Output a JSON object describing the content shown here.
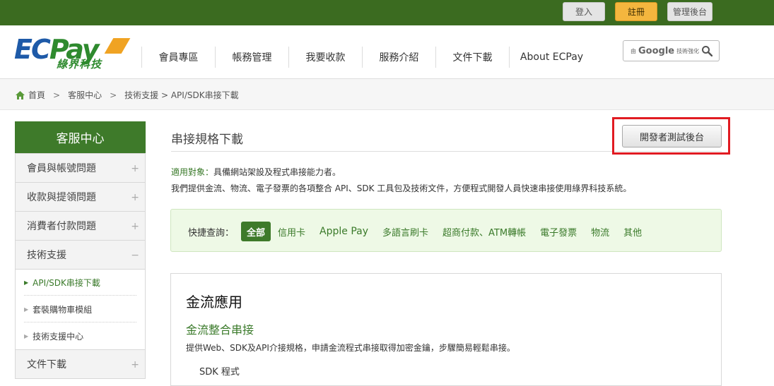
{
  "topbar": {
    "login": "登入",
    "register": "註冊",
    "admin": "管理後台",
    "bg_color": "#3b6b20",
    "register_color": "#f4b63e"
  },
  "logo": {
    "main": "ECPay",
    "sub": "綠界科技"
  },
  "nav": [
    {
      "label": "會員專區"
    },
    {
      "label": "帳務管理"
    },
    {
      "label": "我要收款"
    },
    {
      "label": "服務介紹"
    },
    {
      "label": "文件下載"
    },
    {
      "label": "About ECPay"
    }
  ],
  "search": {
    "prefix": "由",
    "brand": "Google",
    "suffix": "技術強化",
    "icon": "magnifier-icon"
  },
  "breadcrumb": {
    "home": "首頁",
    "sep1": ">",
    "level1": "客服中心",
    "sep2": ">",
    "level2": "技術支援 > API/SDK串接下載",
    "icon": "home-icon"
  },
  "sidebar": {
    "title": "客服中心",
    "items": [
      {
        "label": "會員與帳號問題",
        "toggle": "+"
      },
      {
        "label": "收款與提領問題",
        "toggle": "+"
      },
      {
        "label": "消費者付款問題",
        "toggle": "+"
      },
      {
        "label": "技術支援",
        "toggle": "−"
      }
    ],
    "subitems": [
      {
        "label": "API/SDK串接下載",
        "marker": "▶"
      },
      {
        "label": "套裝購物車模組",
        "marker": "▶"
      },
      {
        "label": "技術支援中心",
        "marker": "▶"
      }
    ],
    "last": {
      "label": "文件下載",
      "toggle": "+"
    },
    "accent": "#3e7a2a"
  },
  "main": {
    "title": "串接規格下載",
    "dev_button": "開發者測試後台",
    "highlight_color": "#e11b22",
    "applicable_label": "適用對象：",
    "applicable_text": "具備網站架設及程式串接能力者。",
    "intro": "我們提供金流、物流、電子發票的各項整合 API、SDK 工具包及技術文件，方便程式開發人員快速串接使用綠界科技系統。",
    "quick": {
      "label": "快捷查詢：",
      "chips": [
        "全部",
        "信用卡",
        "Apple Pay",
        "多語言刷卡",
        "超商付款、ATM轉帳",
        "電子發票",
        "物流",
        "其他"
      ]
    },
    "section": {
      "heading": "金流應用",
      "subheading": "金流整合串接",
      "desc": "提供Web、SDK及API介接規格，申請金流程式串接取得加密金鑰，步驟簡易輕鬆串接。",
      "item": "SDK 程式"
    }
  }
}
